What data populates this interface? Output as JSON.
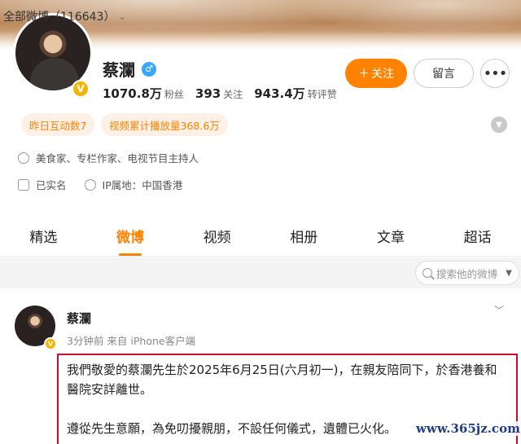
{
  "profile": {
    "name": "蔡瀾",
    "gender_icon": "male-icon",
    "verified_badge": "v-icon",
    "stats": [
      {
        "value": "1070.8万",
        "label": "粉丝"
      },
      {
        "value": "393",
        "label": "关注"
      },
      {
        "value": "943.4万",
        "label": "转评赞"
      }
    ],
    "follow_label": "关注",
    "message_label": "留言",
    "more_icon": "more-dots-icon"
  },
  "chips": [
    "昨日互动数7",
    "视频累计播放量368.6万"
  ],
  "info": {
    "bio": "美食家、专栏作家、电视节目主持人",
    "real_name": "已实名",
    "ip": "IP属地：中国香港"
  },
  "tabs": [
    "精选",
    "微博",
    "视频",
    "相册",
    "文章",
    "超话"
  ],
  "active_tab": "微博",
  "filter": {
    "label": "全部微博（116643）",
    "search_placeholder": "搜索他的微博"
  },
  "post": {
    "author": "蔡瀾",
    "meta": "3分钟前 来自 iPhone客户端",
    "paragraph_1": "我們敬愛的蔡瀾先生於2025年6月25日(六月初一)，在親友陪同下，於香港養和醫院安詳離世。",
    "paragraph_2": "遵從先生意願，為免叨擾親朋，不設任何儀式，遺體已火化。"
  },
  "watermark": "www.365jz.com",
  "colors": {
    "accent": "#ff8200",
    "highlight_border": "#c8102e",
    "watermark": "#1d3c8a"
  }
}
